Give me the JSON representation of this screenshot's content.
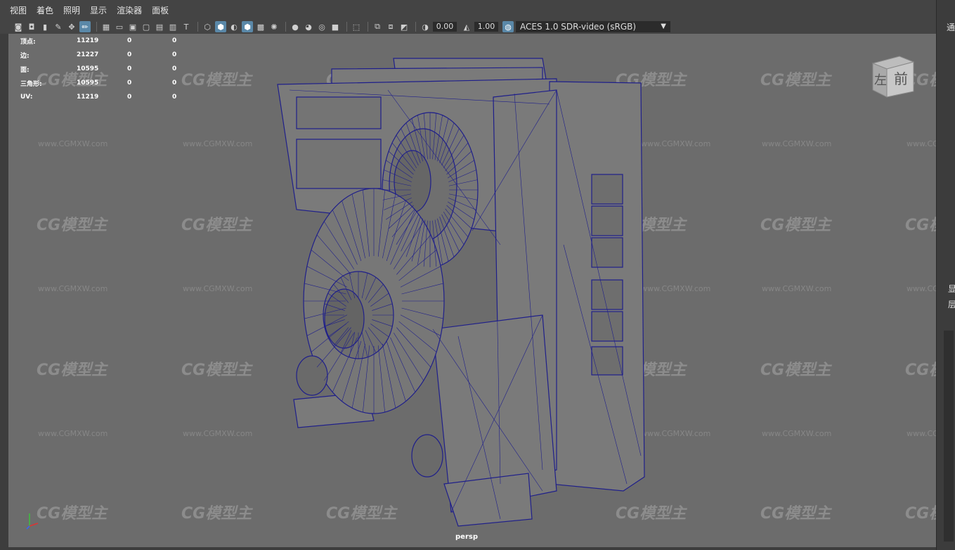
{
  "menu": [
    "视图",
    "着色",
    "照明",
    "显示",
    "渲染器",
    "面板"
  ],
  "toolbar": {
    "exposure": "0.00",
    "gamma": "1.00",
    "color_space": "ACES 1.0 SDR-video (sRGB)"
  },
  "stats": [
    {
      "label": "顶点:",
      "value": "11219",
      "a": "0",
      "b": "0"
    },
    {
      "label": "边:",
      "value": "21227",
      "a": "0",
      "b": "0"
    },
    {
      "label": "面:",
      "value": "10595",
      "a": "0",
      "b": "0"
    },
    {
      "label": "三角形:",
      "value": "10595",
      "a": "0",
      "b": "0"
    },
    {
      "label": "UV:",
      "value": "11219",
      "a": "0",
      "b": "0"
    }
  ],
  "viewcube": {
    "left": "左",
    "front": "前"
  },
  "camera_label": "persp",
  "right_panel": {
    "top": "通",
    "mid1": "显",
    "mid2": "层"
  },
  "watermark": {
    "logo": "CG模型主",
    "url": "www.CGMXW.com"
  },
  "colors": {
    "viewport_bg": "#6c6c6c",
    "wire": "#1f1f8a",
    "shade": "#7a7a7a"
  },
  "icons": [
    "camera-icon",
    "grid-icon",
    "wireframe-icon",
    "shaded-icon",
    "texture-icon",
    "light-icon",
    "xray-icon",
    "isolate-icon",
    "exposure-icon",
    "gamma-icon"
  ]
}
